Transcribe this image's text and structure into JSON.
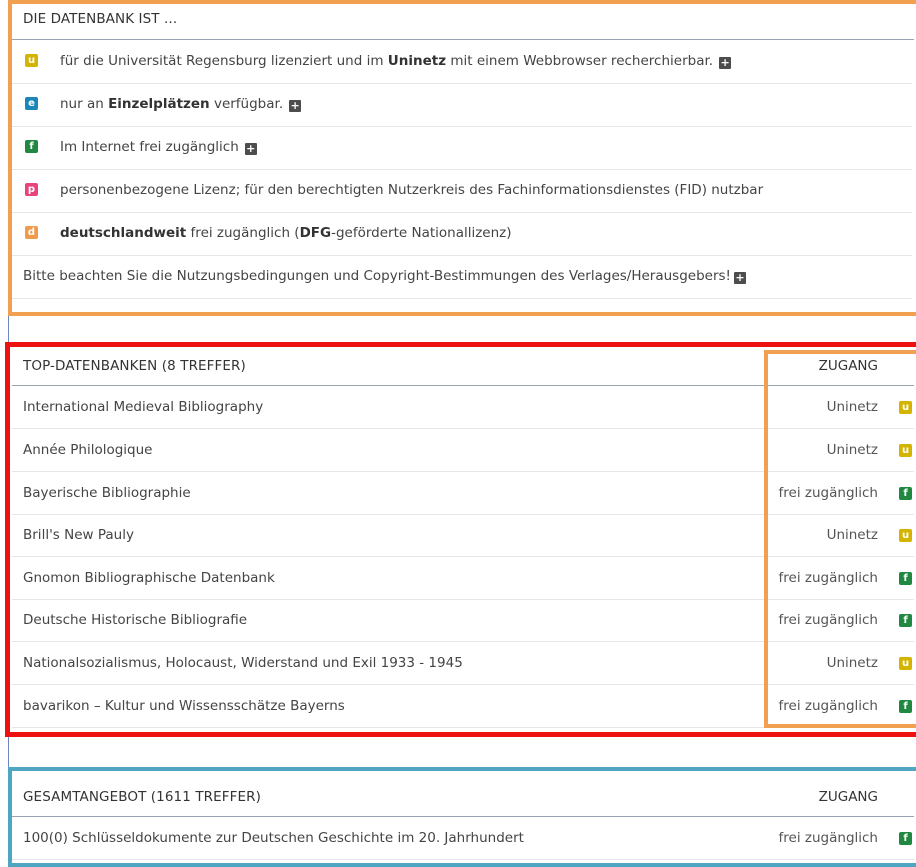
{
  "legend": {
    "title": "DIE DATENBANK IST ...",
    "items": [
      {
        "badge": "u",
        "color": "#d4b400",
        "pre": "für die Universität Regensburg lizenziert und im ",
        "bold": "Uninetz",
        "post": " mit einem Webbrowser recherchierbar.",
        "plus": "+"
      },
      {
        "badge": "e",
        "color": "#1b87b8",
        "pre": "nur an ",
        "bold": "Einzelplätzen",
        "post": " verfügbar.",
        "plus": "+"
      },
      {
        "badge": "f",
        "color": "#208840",
        "pre": "Im Internet frei zugänglich",
        "bold": "",
        "post": "",
        "plus": "+"
      },
      {
        "badge": "p",
        "color": "#e8447a",
        "pre": "personenbezogene Lizenz; für den berechtigten Nutzerkreis des Fachinformationsdienstes (FID) nutzbar",
        "bold": "",
        "post": "",
        "plus": ""
      },
      {
        "badge": "d",
        "color": "#f09a4a",
        "pre": "",
        "bold": "deutschlandweit",
        "post": " frei zugänglich (",
        "bold2": "DFG",
        "post2": "-geförderte Nationallizenz)",
        "plus": ""
      }
    ],
    "note": "Bitte beachten Sie die Nutzungsbedingungen und Copyright-Bestimmungen des Verlages/Herausgebers!",
    "note_plus": "+"
  },
  "top": {
    "title": "TOP-DATENBANKEN (8 TREFFER)",
    "access_header": "ZUGANG",
    "rows": [
      {
        "name": "International Medieval Bibliography",
        "access": "Uninetz",
        "badge": "u"
      },
      {
        "name": "Année Philologique",
        "access": "Uninetz",
        "badge": "u"
      },
      {
        "name": "Bayerische Bibliographie",
        "access": "frei zugänglich",
        "badge": "f"
      },
      {
        "name": "Brill's New Pauly",
        "access": "Uninetz",
        "badge": "u"
      },
      {
        "name": "Gnomon Bibliographische Datenbank",
        "access": "frei zugänglich",
        "badge": "f"
      },
      {
        "name": "Deutsche Historische Bibliografie",
        "access": "frei zugänglich",
        "badge": "f"
      },
      {
        "name": "Nationalsozialismus, Holocaust, Widerstand und Exil 1933 - 1945",
        "access": "Uninetz",
        "badge": "u"
      },
      {
        "name": "bavarikon – Kultur und Wissensschätze Bayerns",
        "access": "frei zugänglich",
        "badge": "f"
      }
    ]
  },
  "all": {
    "title": "GESAMTANGEBOT (1611 TREFFER)",
    "access_header": "ZUGANG",
    "rows": [
      {
        "name": "100(0) Schlüsseldokumente zur Deutschen Geschichte im 20. Jahrhundert",
        "access": "frei zugänglich",
        "badge": "f"
      }
    ]
  },
  "colors": {
    "legend_box": "#f0a050",
    "top_box": "#ee1111",
    "access_box": "#f0a050",
    "all_box": "#4ea6c2"
  }
}
